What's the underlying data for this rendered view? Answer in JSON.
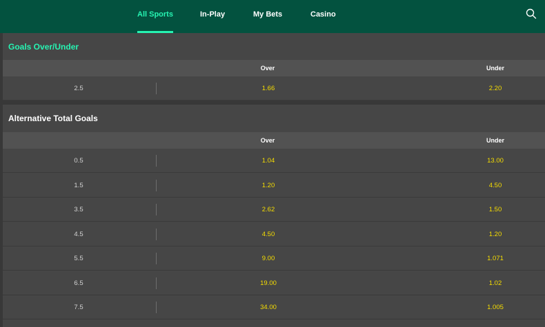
{
  "nav": {
    "items": [
      {
        "label": "All Sports",
        "active": true
      },
      {
        "label": "In-Play",
        "active": false
      },
      {
        "label": "My Bets",
        "active": false
      },
      {
        "label": "Casino",
        "active": false
      }
    ],
    "search_icon": "search-icon"
  },
  "colors": {
    "header_bg": "#03523f",
    "accent": "#26f4b2",
    "odds": "#f6dd00",
    "panel_bg": "#464646",
    "column_header_bg": "#525252"
  },
  "goals_over_under": {
    "title": "Goals Over/Under",
    "col_over": "Over",
    "col_under": "Under",
    "rows": [
      {
        "line": "2.5",
        "over": "1.66",
        "under": "2.20"
      }
    ]
  },
  "alternative_total_goals": {
    "title": "Alternative Total Goals",
    "col_over": "Over",
    "col_under": "Under",
    "rows": [
      {
        "line": "0.5",
        "over": "1.04",
        "under": "13.00"
      },
      {
        "line": "1.5",
        "over": "1.20",
        "under": "4.50"
      },
      {
        "line": "3.5",
        "over": "2.62",
        "under": "1.50"
      },
      {
        "line": "4.5",
        "over": "4.50",
        "under": "1.20"
      },
      {
        "line": "5.5",
        "over": "9.00",
        "under": "1.071"
      },
      {
        "line": "6.5",
        "over": "19.00",
        "under": "1.02"
      },
      {
        "line": "7.5",
        "over": "34.00",
        "under": "1.005"
      }
    ]
  }
}
